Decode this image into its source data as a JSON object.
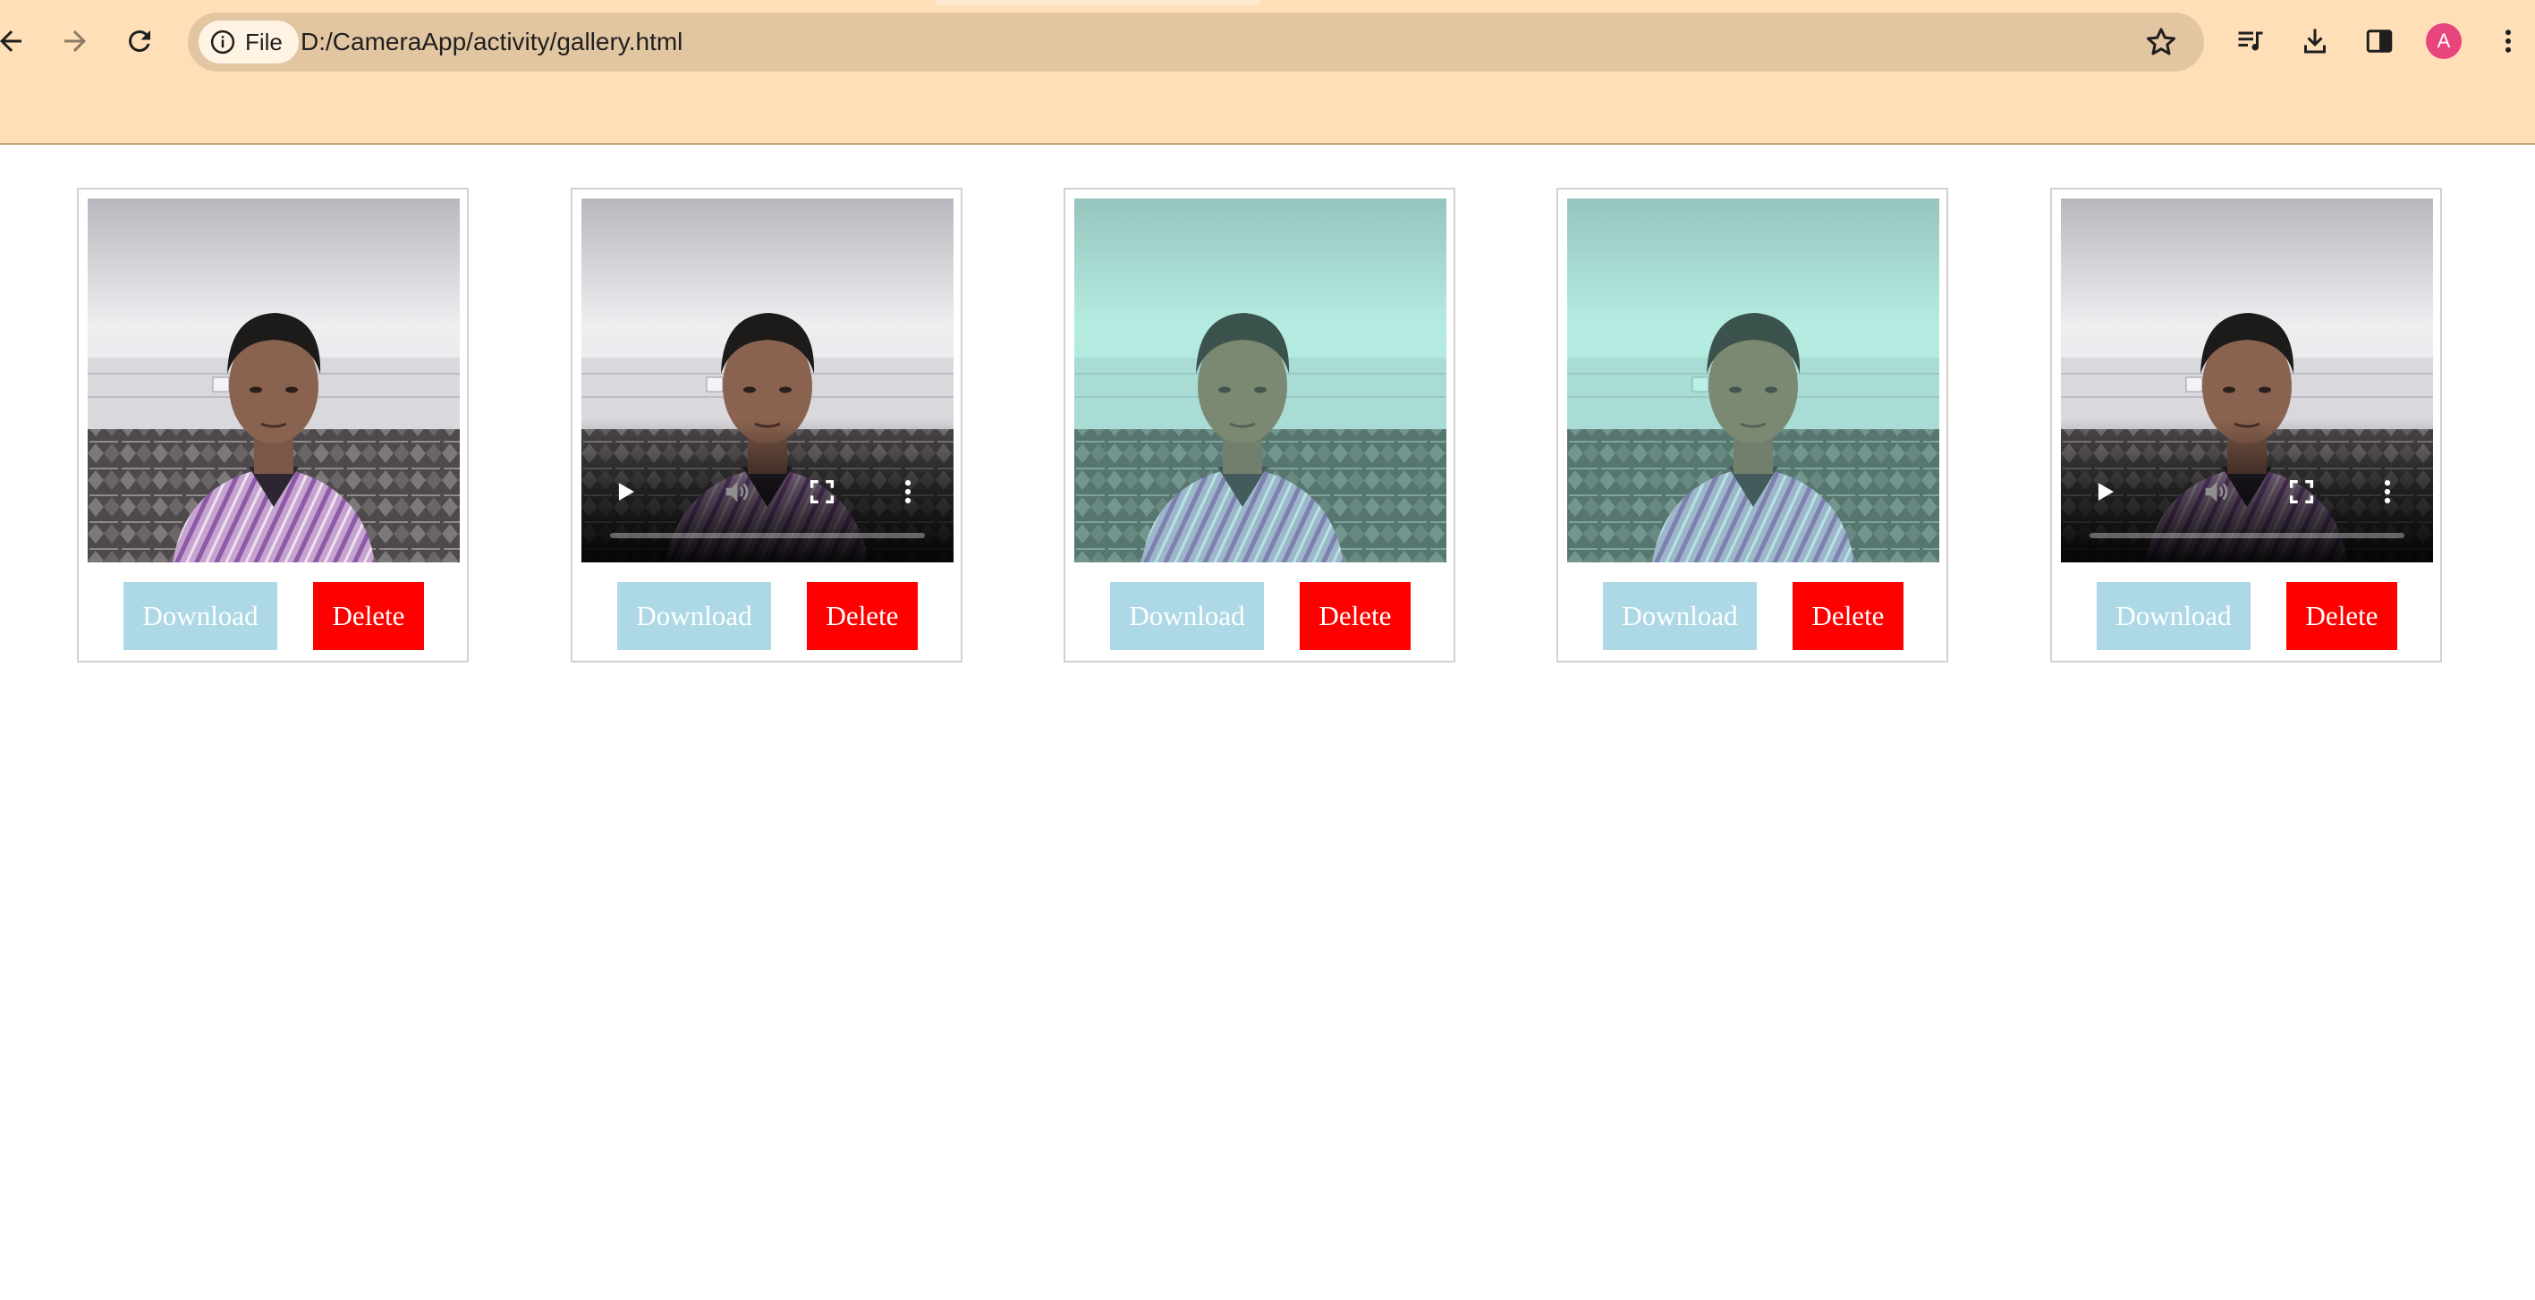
{
  "browser": {
    "site_chip_label": "File",
    "url": "D:/CameraApp/activity/gallery.html",
    "profile_initial": "A",
    "icons": {
      "back": "back-arrow-icon",
      "forward": "forward-arrow-icon",
      "reload": "reload-icon",
      "info": "info-icon",
      "bookmark": "star-icon",
      "media": "media-queue-icon",
      "downloads": "download-icon",
      "side_panel": "side-panel-icon",
      "menu": "more-vert-icon"
    }
  },
  "colors": {
    "chrome_bg": "#ffdfb8",
    "omnibox_bg": "#e2c6a2",
    "download_button": "#add8e6",
    "delete_button": "#ff0000",
    "avatar": "#e8457e"
  },
  "gallery": {
    "items": [
      {
        "type": "image",
        "filter": "none",
        "download_label": "Download",
        "delete_label": "Delete"
      },
      {
        "type": "video",
        "filter": "none",
        "progress": 0,
        "download_label": "Download",
        "delete_label": "Delete"
      },
      {
        "type": "image",
        "filter": "teal",
        "download_label": "Download",
        "delete_label": "Delete"
      },
      {
        "type": "image",
        "filter": "teal",
        "download_label": "Download",
        "delete_label": "Delete"
      },
      {
        "type": "video",
        "filter": "none",
        "progress": 0,
        "download_label": "Download",
        "delete_label": "Delete"
      }
    ]
  }
}
